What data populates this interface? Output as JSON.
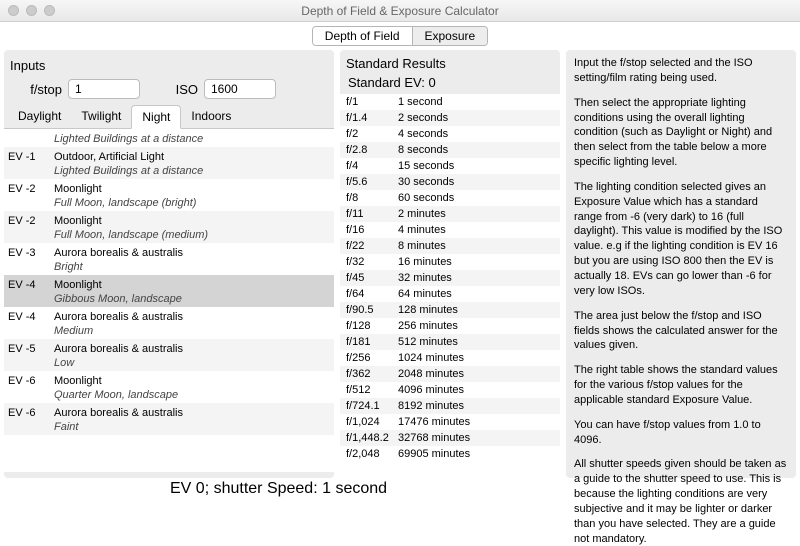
{
  "window": {
    "title": "Depth of Field & Exposure Calculator"
  },
  "toptabs": {
    "depth": "Depth of Field",
    "exposure": "Exposure"
  },
  "inputs": {
    "title": "Inputs",
    "fstop_label": "f/stop",
    "fstop_value": "1",
    "iso_label": "ISO",
    "iso_value": "1600"
  },
  "lighttabs": {
    "daylight": "Daylight",
    "twilight": "Twilight",
    "night": "Night",
    "indoors": "Indoors"
  },
  "lighting_rows": [
    {
      "ev": "",
      "name": "",
      "sub": "Lighted Buildings at a distance"
    },
    {
      "ev": "EV -1",
      "name": "Outdoor, Artificial Light",
      "sub": "Lighted Buildings at a distance"
    },
    {
      "ev": "EV -2",
      "name": "Moonlight",
      "sub": "Full Moon, landscape (bright)"
    },
    {
      "ev": "EV -2",
      "name": "Moonlight",
      "sub": "Full Moon, landscape (medium)"
    },
    {
      "ev": "EV -3",
      "name": "Aurora borealis & australis",
      "sub": "Bright"
    },
    {
      "ev": "EV -4",
      "name": "Moonlight",
      "sub": "Gibbous Moon, landscape"
    },
    {
      "ev": "EV -4",
      "name": "Aurora borealis & australis",
      "sub": "Medium"
    },
    {
      "ev": "EV -5",
      "name": "Aurora borealis & australis",
      "sub": "Low"
    },
    {
      "ev": "EV -6",
      "name": "Moonlight",
      "sub": "Quarter Moon, landscape"
    },
    {
      "ev": "EV -6",
      "name": "Aurora borealis & australis",
      "sub": "Faint"
    }
  ],
  "lighting_selected_index": 5,
  "results": {
    "title": "Standard Results",
    "subtitle": "Standard EV: 0",
    "rows": [
      {
        "f": "f/1",
        "s": "1 second"
      },
      {
        "f": "f/1.4",
        "s": "2 seconds"
      },
      {
        "f": "f/2",
        "s": "4 seconds"
      },
      {
        "f": "f/2.8",
        "s": "8 seconds"
      },
      {
        "f": "f/4",
        "s": "15 seconds"
      },
      {
        "f": "f/5.6",
        "s": "30 seconds"
      },
      {
        "f": "f/8",
        "s": "60 seconds"
      },
      {
        "f": "f/11",
        "s": "2 minutes"
      },
      {
        "f": "f/16",
        "s": "4 minutes"
      },
      {
        "f": "f/22",
        "s": "8 minutes"
      },
      {
        "f": "f/32",
        "s": "16 minutes"
      },
      {
        "f": "f/45",
        "s": "32 minutes"
      },
      {
        "f": "f/64",
        "s": "64 minutes"
      },
      {
        "f": "f/90.5",
        "s": "128 minutes"
      },
      {
        "f": "f/128",
        "s": "256 minutes"
      },
      {
        "f": "f/181",
        "s": "512 minutes"
      },
      {
        "f": "f/256",
        "s": "1024 minutes"
      },
      {
        "f": "f/362",
        "s": "2048 minutes"
      },
      {
        "f": "f/512",
        "s": "4096 minutes"
      },
      {
        "f": "f/724.1",
        "s": "8192 minutes"
      },
      {
        "f": "f/1,024",
        "s": "17476 minutes"
      },
      {
        "f": "f/1,448.2",
        "s": "32768 minutes"
      },
      {
        "f": "f/2,048",
        "s": "69905 minutes"
      }
    ]
  },
  "info": {
    "p1": "Input the f/stop selected and the ISO setting/film rating being used.",
    "p2": "Then select the appropriate lighting conditions using the overall lighting condition (such as Daylight or Night) and then select from the table below a more specific lighting level.",
    "p3": "The lighting condition selected gives an Exposure Value which has a standard range from -6 (very dark) to 16 (full daylight).  This value is modified by the ISO value.  e.g if the lighting condition is EV 16 but you are using ISO 800 then the EV is actually 18.  EVs can go lower than -6 for very low ISOs.",
    "p4": "The area just below the f/stop and ISO fields shows the calculated answer for the values given.",
    "p5": "The right table shows the standard values for the various f/stop values for the applicable standard Exposure Value.",
    "p6": "You can have f/stop values from 1.0 to 4096.",
    "p7": "All shutter speeds given should be taken as a guide to the shutter speed to use.  This is because the lighting conditions are very subjective and it may be lighter or darker than you have selected.  They are a guide not mandatory."
  },
  "bottom": "EV 0; shutter Speed: 1 second"
}
